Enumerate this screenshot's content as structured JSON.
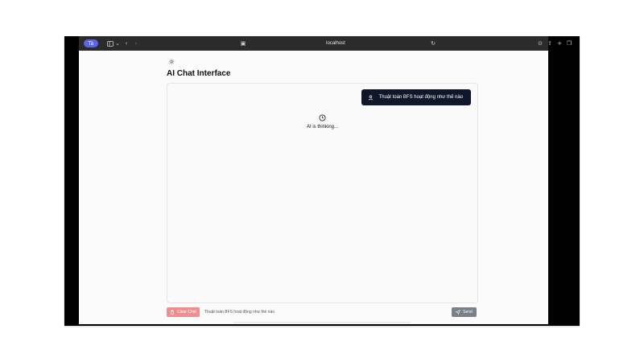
{
  "browser": {
    "profile_label": "Tà",
    "address": "localhost"
  },
  "app": {
    "title": "AI Chat Interface",
    "theme_icon": "sun-icon"
  },
  "chat": {
    "user_message": "Thuật toán BFS hoạt động như thế nào",
    "thinking_text": "AI is thinking...",
    "user_icon": "user-icon",
    "thinking_icon": "clock-icon"
  },
  "composer": {
    "clear_label": "Clear Chat",
    "input_value": "Thuật toán BFS hoạt động như thế nào",
    "send_label": "Send"
  },
  "colors": {
    "accent_profile": "#5c63e6",
    "user_bubble": "#0f172a",
    "clear_button": "#ef8e8e",
    "send_button": "#7b808a"
  }
}
